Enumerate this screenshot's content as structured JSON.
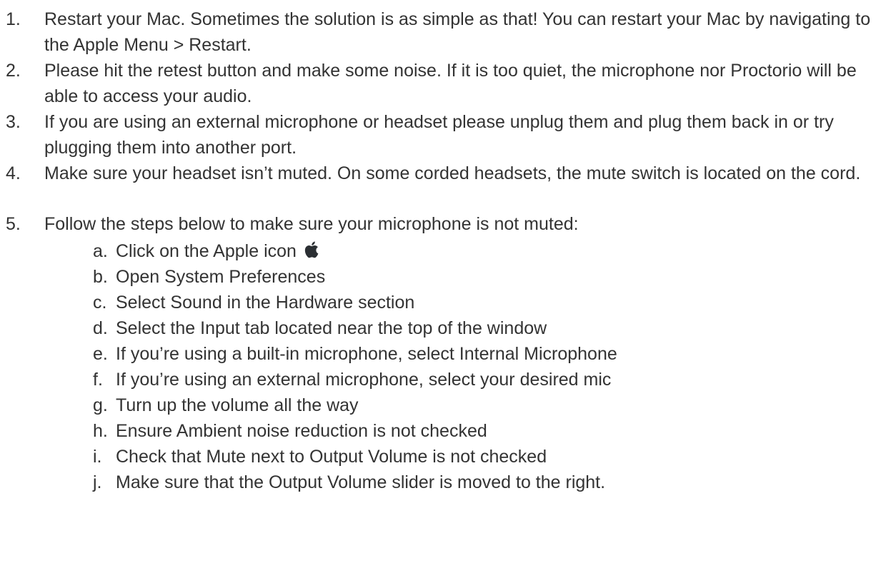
{
  "steps": [
    {
      "marker": "1.",
      "text": "Restart your Mac. Sometimes the solution is as simple as that! You can restart your Mac by navigating to the Apple Menu > Restart."
    },
    {
      "marker": "2.",
      "text": "Please hit the retest button and make some noise. If it is too quiet, the microphone nor Proctorio will be able to access your audio."
    },
    {
      "marker": "3.",
      "text": "If you are using an external microphone or headset please unplug them and plug them back in or try plugging them into another port."
    },
    {
      "marker": "4.",
      "text": "Make sure your headset isn’t muted. On some corded headsets, the mute switch is located on the cord."
    },
    {
      "marker": "5.",
      "text": "Follow the steps below to make sure your microphone is not muted:"
    }
  ],
  "substeps": [
    {
      "marker": "a.",
      "text": "Click on the Apple icon",
      "icon": "apple-logo-icon"
    },
    {
      "marker": "b.",
      "text": "Open System Preferences"
    },
    {
      "marker": "c.",
      "text": "Select Sound in the Hardware section"
    },
    {
      "marker": "d.",
      "text": "Select the Input tab located near the top of the window"
    },
    {
      "marker": "e.",
      "text": "If you’re using a built-in microphone, select Internal Microphone"
    },
    {
      "marker": "f.",
      "text": "If you’re using an external microphone, select your desired mic"
    },
    {
      "marker": "g.",
      "text": "Turn up the volume all the way"
    },
    {
      "marker": "h.",
      "text": "Ensure Ambient noise reduction is not checked"
    },
    {
      "marker": "i.",
      "text": "Check that Mute next to Output Volume is not checked"
    },
    {
      "marker": "j.",
      "text": "Make sure that the Output Volume slider is moved to the right."
    }
  ],
  "colors": {
    "text": "#333333",
    "background": "#ffffff"
  }
}
